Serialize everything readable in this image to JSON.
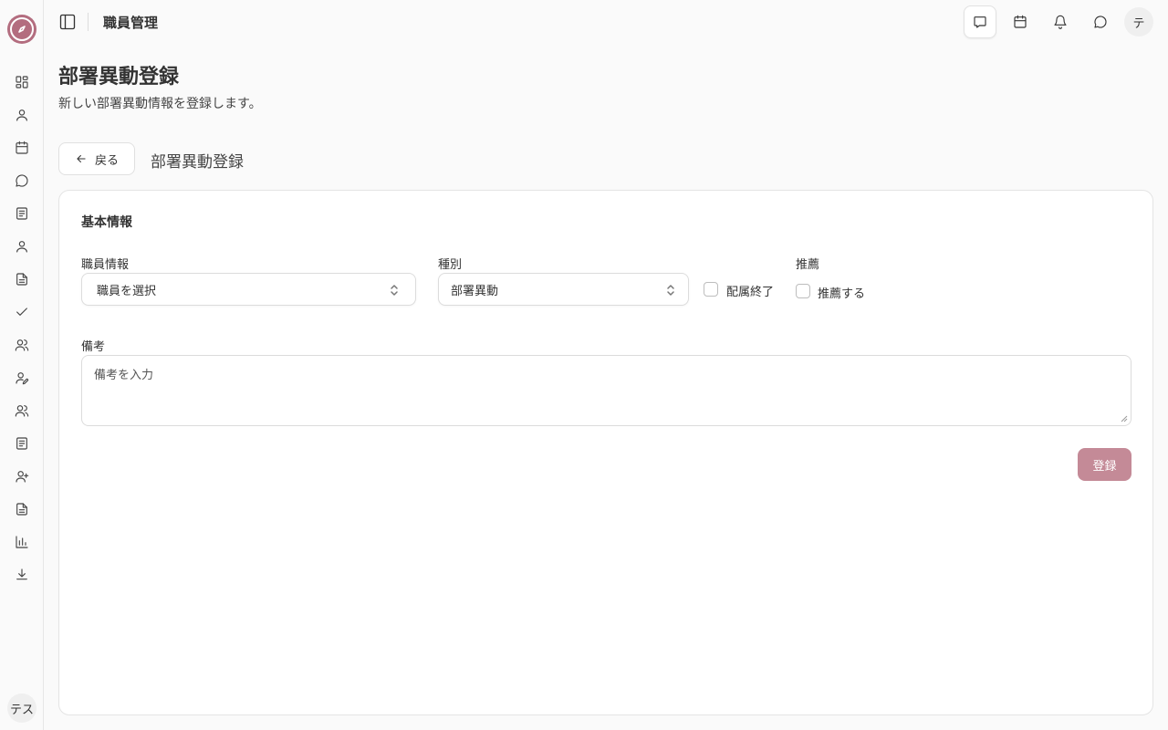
{
  "header": {
    "title": "職員管理",
    "user_initial": "テ"
  },
  "sidebar": {
    "user_label": "テス",
    "items": [
      {
        "icon": "dashboard-icon"
      },
      {
        "icon": "user-icon"
      },
      {
        "icon": "calendar-icon"
      },
      {
        "icon": "message-circle-icon"
      },
      {
        "icon": "notebook-icon"
      },
      {
        "icon": "user-icon"
      },
      {
        "icon": "file-text-icon"
      },
      {
        "icon": "check-icon"
      },
      {
        "icon": "users-icon"
      },
      {
        "icon": "user-pen-icon"
      },
      {
        "icon": "users-icon"
      },
      {
        "icon": "notebook-icon"
      },
      {
        "icon": "user-plus-icon"
      },
      {
        "icon": "file-text-icon"
      },
      {
        "icon": "bar-chart-icon"
      },
      {
        "icon": "download-icon"
      }
    ]
  },
  "page": {
    "title": "部署異動登録",
    "subtitle": "新しい部署異動情報を登録します。",
    "back_label": "戻る",
    "section_heading": "部署異動登録"
  },
  "form": {
    "card_title": "基本情報",
    "employee": {
      "label": "職員情報",
      "placeholder": "職員を選択"
    },
    "type": {
      "label": "種別",
      "value": "部署異動"
    },
    "end_assignment": {
      "label": "配属終了",
      "checked": false
    },
    "recommend": {
      "label": "推薦",
      "checkbox_label": "推薦する",
      "checked": false
    },
    "notes": {
      "label": "備考",
      "placeholder": "備考を入力"
    },
    "submit_label": "登録"
  },
  "colors": {
    "accent": "#b36d7f",
    "submit_button": "#c48a97"
  }
}
